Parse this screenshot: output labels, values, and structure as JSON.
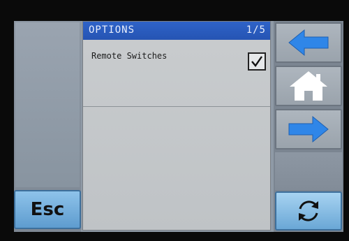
{
  "header": {
    "title": "OPTIONS",
    "page_indicator": "1/5"
  },
  "options": [
    {
      "label": "Remote Switches",
      "checked": true
    }
  ],
  "buttons": {
    "esc_label": "Esc"
  },
  "icons": {
    "back": "left-arrow-icon",
    "home": "home-icon",
    "next": "right-arrow-icon",
    "refresh": "refresh-icon"
  },
  "colors": {
    "title_bar": "#2f63c8",
    "arrow_blue": "#2f86e8",
    "esc_button": "#7ab3e0"
  }
}
